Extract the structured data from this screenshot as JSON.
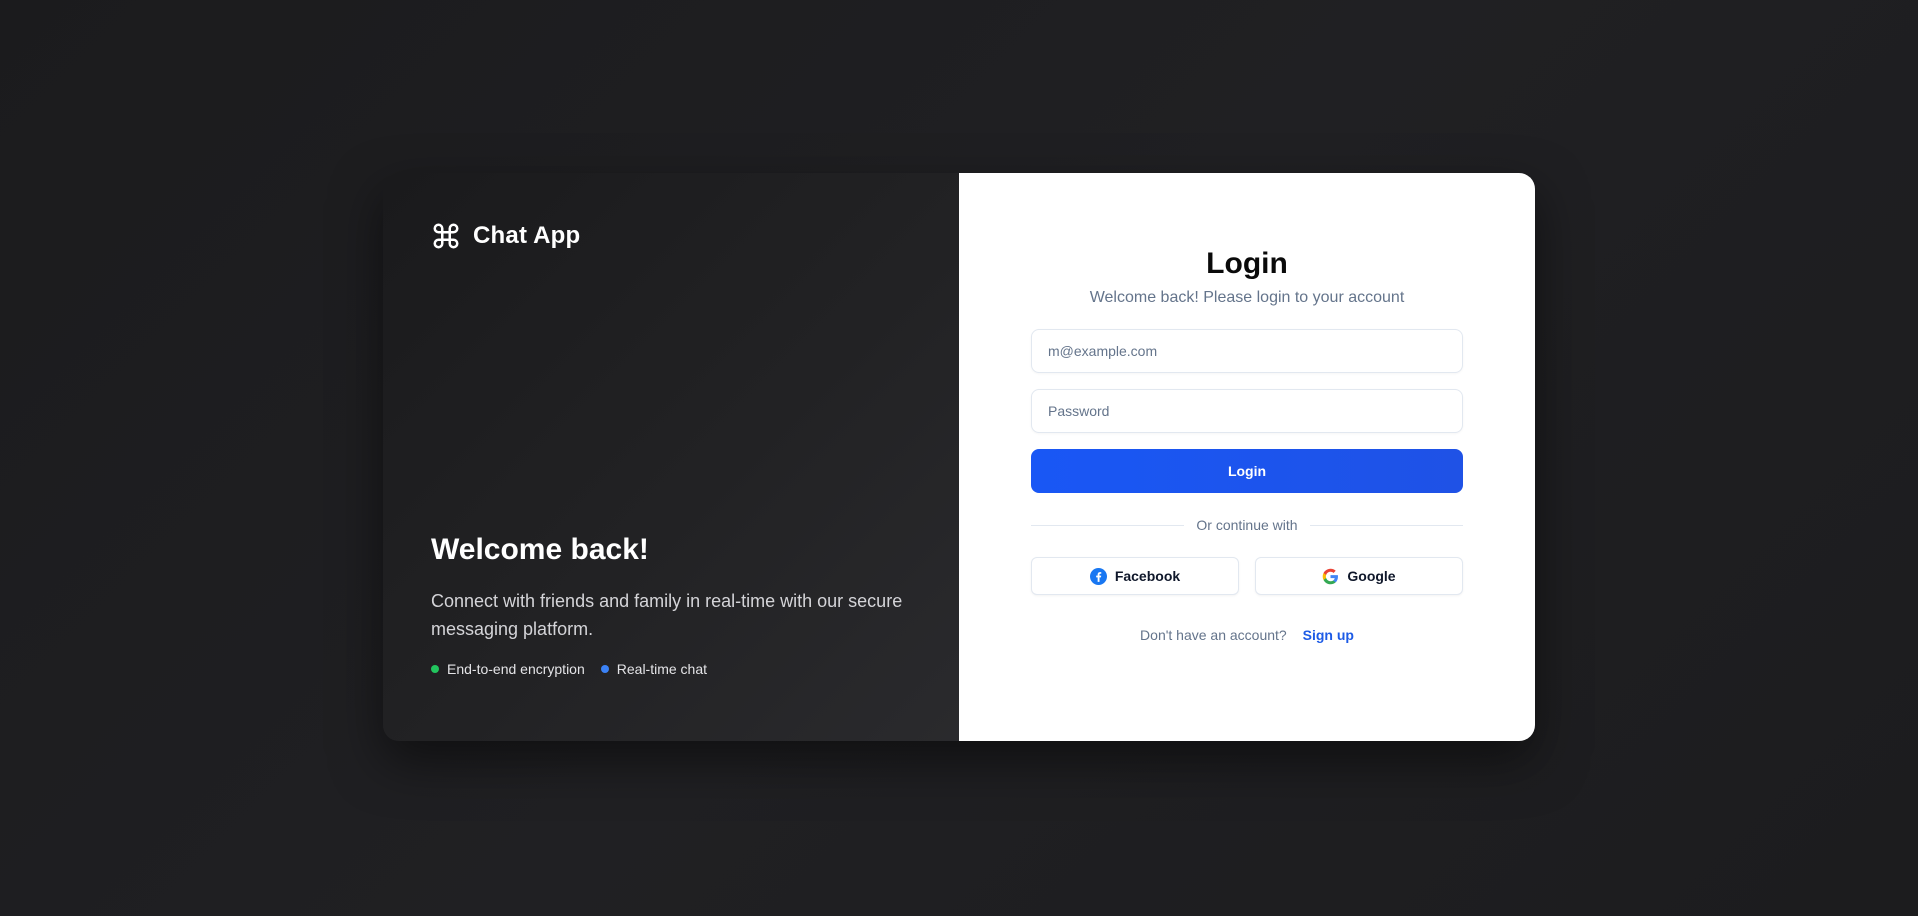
{
  "brand": {
    "name": "Chat App",
    "icon": "command-icon"
  },
  "hero": {
    "title": "Welcome back!",
    "text": "Connect with friends and family in real-time with our secure messaging platform.",
    "features": [
      {
        "label": "End-to-end encryption",
        "color": "#22c55e"
      },
      {
        "label": "Real-time chat",
        "color": "#3b82f6"
      }
    ]
  },
  "login": {
    "title": "Login",
    "subtitle": "Welcome back! Please login to your account",
    "email_placeholder": "m@example.com",
    "email_value": "",
    "password_placeholder": "Password",
    "password_value": "",
    "submit_label": "Login",
    "divider_text": "Or continue with",
    "socials": [
      {
        "label": "Facebook",
        "icon": "facebook-icon"
      },
      {
        "label": "Google",
        "icon": "google-icon"
      }
    ],
    "signup_prompt": "Don't have an account?",
    "signup_link": "Sign up"
  },
  "colors": {
    "accent": "#1957f5",
    "link": "#1d5be6",
    "background": "#1e1e20"
  }
}
